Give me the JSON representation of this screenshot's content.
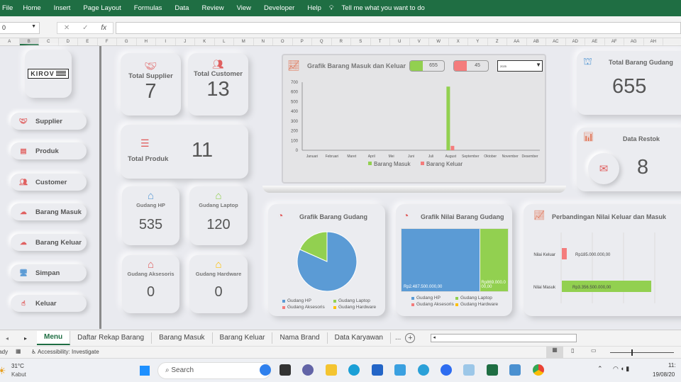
{
  "ribbon": {
    "tabs": [
      "File",
      "Home",
      "Insert",
      "Page Layout",
      "Formulas",
      "Data",
      "Review",
      "View",
      "Developer",
      "Help"
    ],
    "tell_me": "Tell me what you want to do"
  },
  "formula_bar": {
    "name_box": "0",
    "value": ""
  },
  "columns": [
    "A",
    "B",
    "C",
    "D",
    "E",
    "F",
    "G",
    "H",
    "I",
    "J",
    "K",
    "L",
    "M",
    "N",
    "O",
    "P",
    "Q",
    "R",
    "S",
    "T",
    "U",
    "V",
    "W",
    "X",
    "Y",
    "Z",
    "AA",
    "AB",
    "AC",
    "AD",
    "AE",
    "AF",
    "AG",
    "AH"
  ],
  "logo": "KIROV",
  "nav": [
    {
      "label": "Supplier",
      "icon": "handshake-icon"
    },
    {
      "label": "Produk",
      "icon": "document-icon"
    },
    {
      "label": "Customer",
      "icon": "users-icon"
    },
    {
      "label": "Barang Masuk",
      "icon": "cloud-upload-icon"
    },
    {
      "label": "Barang Keluar",
      "icon": "cloud-download-icon"
    },
    {
      "label": "Simpan",
      "icon": "monitor-icon"
    },
    {
      "label": "Keluar",
      "icon": "hand-pointer-icon"
    }
  ],
  "stats": {
    "supplier": {
      "label": "Total Supplier",
      "value": "7"
    },
    "customer": {
      "label": "Total Customer",
      "value": "13"
    },
    "produk": {
      "label": "Total Produk",
      "value": "11"
    },
    "gudang_hp": {
      "label": "Gudang HP",
      "value": "535"
    },
    "gudang_laptop": {
      "label": "Gudang Laptop",
      "value": "120"
    },
    "gudang_aksesoris": {
      "label": "Gudang Aksesoris",
      "value": "0"
    },
    "gudang_hardware": {
      "label": "Gudang Hardware",
      "value": "0"
    },
    "total_gudang": {
      "label": "Total Barang Gudang",
      "value": "655"
    },
    "restok": {
      "label": "Data Restok",
      "value": "8"
    }
  },
  "colors": {
    "green": "#92d050",
    "red": "#f47c7c",
    "blue": "#5b9bd5",
    "yellow": "#ffc000"
  },
  "chart_data": [
    {
      "type": "bar",
      "title": "Grafik Barang Masuk dan Keluar",
      "categories": [
        "Januari",
        "Februari",
        "Maret",
        "April",
        "Mei",
        "Juni",
        "Juli",
        "August",
        "September",
        "Oktober",
        "November",
        "Desember"
      ],
      "series": [
        {
          "name": "Barang Masuk",
          "values": [
            0,
            0,
            0,
            0,
            0,
            0,
            0,
            655,
            0,
            0,
            0,
            0
          ]
        },
        {
          "name": "Barang Keluar",
          "values": [
            0,
            0,
            0,
            0,
            0,
            0,
            0,
            45,
            0,
            0,
            0,
            0
          ]
        }
      ],
      "ylim": [
        0,
        700
      ],
      "yticks": [
        "0",
        "100",
        "200",
        "300",
        "400",
        "500",
        "600",
        "700"
      ],
      "legend": "bottom",
      "masuk_total": "655",
      "keluar_total": "45",
      "year_select": "2025"
    },
    {
      "type": "pie",
      "title": "Grafik Barang Gudang",
      "labels": [
        "Gudang HP",
        "Gudang Laptop",
        "Gudang Aksesoris",
        "Gudang Hardware"
      ],
      "values": [
        535,
        120,
        0,
        0
      ],
      "legend": "bottom"
    },
    {
      "type": "treemap",
      "title": "Grafik Nilai Barang Gudang",
      "labels": [
        "Gudang HP",
        "Gudang Laptop",
        "Gudang Aksesoris",
        "Gudang Hardware"
      ],
      "values": [
        2487500000,
        869000000,
        0,
        0
      ],
      "data_labels": [
        "Rp2.487.500.000,00",
        "Rp869.000.000,00"
      ],
      "legend": "bottom"
    },
    {
      "type": "bar",
      "orientation": "horizontal",
      "title": "Perbandingan Nilai Keluar dan Masuk",
      "categories": [
        "Nilai Keluar",
        "Nilai Masuk"
      ],
      "values": [
        185000000,
        3356500000
      ],
      "data_labels": [
        "Rp185.000.000,00",
        "Rp3.356.500.000,00"
      ]
    }
  ],
  "sheet_tabs": [
    "Menu",
    "Daftar Rekap Barang",
    "Barang Masuk",
    "Barang Keluar",
    "Nama Brand",
    "Data Karyawan",
    "..."
  ],
  "status": {
    "ready": "Ready",
    "accessibility": "Accessibility: Investigate"
  },
  "taskbar": {
    "temp": "31°C",
    "weather": "Kabut",
    "search": "Search",
    "time": "11:",
    "date": "19/08/20"
  }
}
